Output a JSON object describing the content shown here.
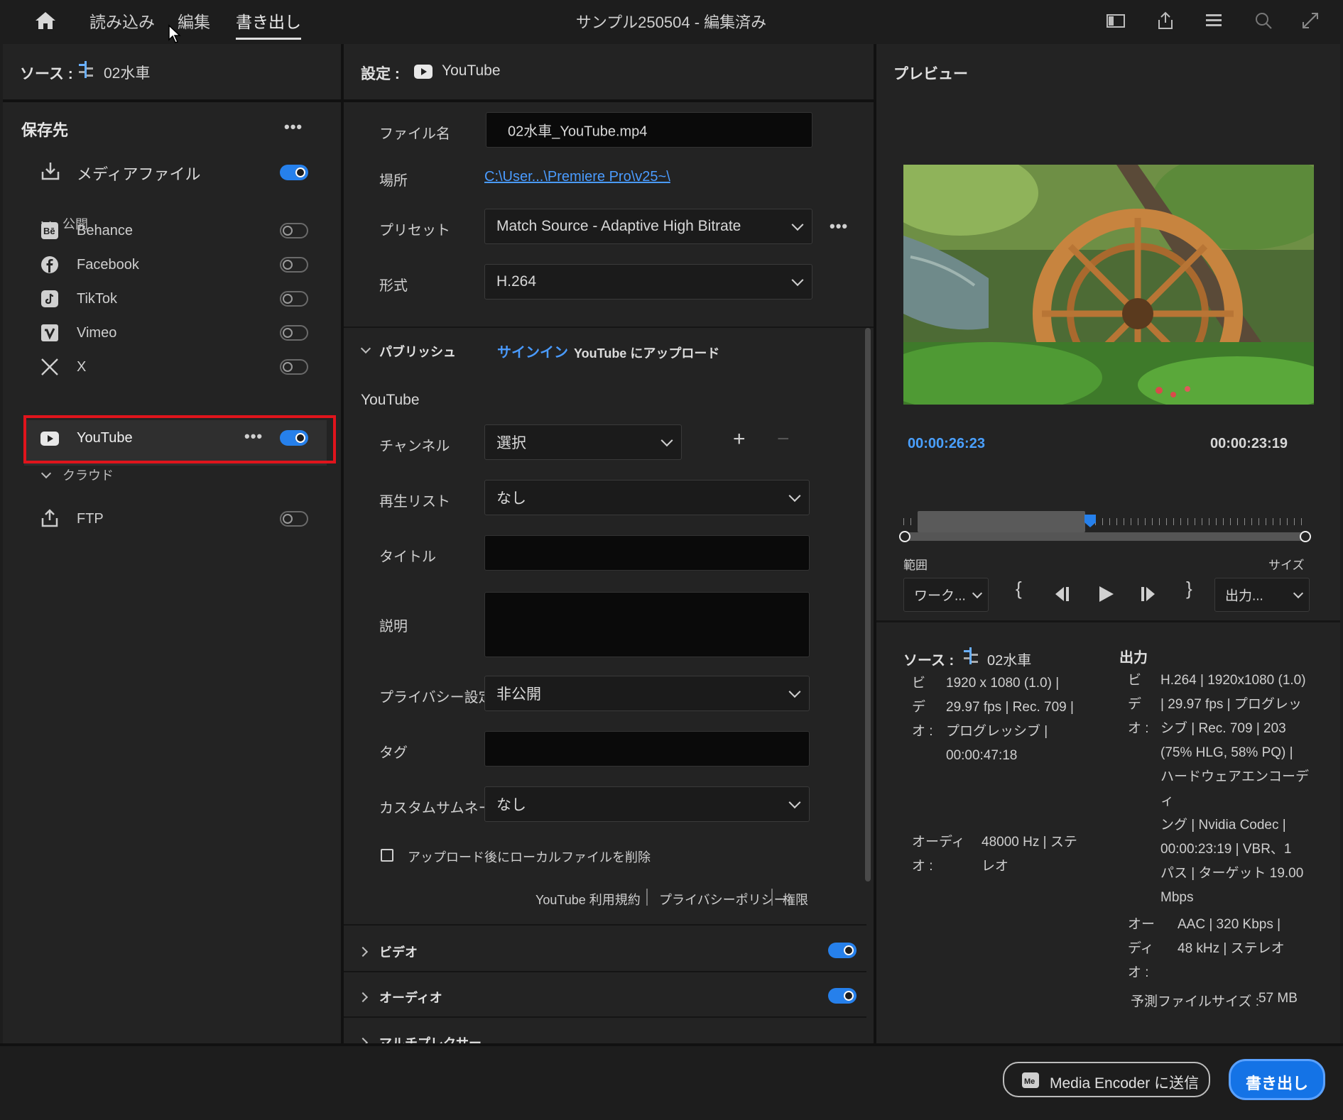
{
  "topbar": {
    "tabs": [
      "読み込み",
      "編集",
      "書き出し"
    ],
    "title": "サンプル250504 - 編集済み"
  },
  "source": {
    "label": "ソース :",
    "name": "02水車"
  },
  "destinations": {
    "header": "保存先",
    "media_file": {
      "label": "メディアファイル",
      "on": true
    },
    "publish_group": "公開",
    "publish_items": [
      {
        "label": "Behance",
        "icon": "behance-icon",
        "on": false
      },
      {
        "label": "Facebook",
        "icon": "facebook-icon",
        "on": false
      },
      {
        "label": "TikTok",
        "icon": "tiktok-icon",
        "on": false
      },
      {
        "label": "Vimeo",
        "icon": "vimeo-icon",
        "on": false
      },
      {
        "label": "X",
        "icon": "x-icon",
        "on": false
      },
      {
        "label": "YouTube",
        "icon": "youtube-icon",
        "on": true
      }
    ],
    "cloud_group": "クラウド",
    "ftp": {
      "label": "FTP",
      "on": false
    },
    "highlight_color": "#e0141c"
  },
  "settings": {
    "label": "設定 :",
    "target": "YouTube",
    "filename_label": "ファイル名",
    "filename_value": "02水車_YouTube.mp4",
    "location_label": "場所",
    "location_value": "C:\\User...\\Premiere Pro\\v25~\\",
    "preset_label": "プリセット",
    "preset_value": "Match Source - Adaptive High Bitrate",
    "format_label": "形式",
    "format_value": "H.264",
    "publish_section": "パブリッシュ",
    "sign_in": "サインイン",
    "upload_text": "YouTube にアップロード",
    "youtube_header": "YouTube",
    "channel_label": "チャンネル",
    "channel_value": "選択",
    "playlist_label": "再生リスト",
    "playlist_value": "なし",
    "title_label": "タイトル",
    "description_label": "説明",
    "privacy_label": "プライバシー設定",
    "privacy_value": "非公開",
    "tag_label": "タグ",
    "thumbnail_label": "カスタムサムネール",
    "thumbnail_value": "なし",
    "delete_checkbox": "アップロード後にローカルファイルを削除",
    "links": [
      "YouTube 利用規約",
      "プライバシーポリシー",
      "権限"
    ],
    "video_section": "ビデオ",
    "audio_section": "オーディオ",
    "mux_section": "マルチプレクサー"
  },
  "preview": {
    "header": "プレビュー",
    "timecode_current": "00:00:26:23",
    "timecode_duration": "00:00:23:19",
    "range_label": "範囲",
    "range_value": "ワーク...",
    "size_label": "サイズ",
    "size_value": "出力..."
  },
  "summary": {
    "source_label": "ソース :",
    "source_name": "02水車",
    "source_video_key": [
      "ビ",
      "デ",
      "オ :"
    ],
    "source_video_lines": [
      "1920 x 1080 (1.0) |",
      "29.97 fps | Rec. 709 |",
      "プログレッシブ |",
      "00:00:47:18"
    ],
    "source_audio_key": [
      "オーディ",
      "オ :"
    ],
    "source_audio_lines": [
      "48000 Hz | ステ",
      "レオ"
    ],
    "output_label": "出力",
    "output_video_key": [
      "ビ",
      "デ",
      "オ :"
    ],
    "output_video_lines": [
      "H.264 | 1920x1080 (1.0)",
      " | 29.97 fps | プログレッ",
      "シブ | Rec. 709 | 203",
      "(75% HLG, 58% PQ) |",
      "ハードウェアエンコーディ",
      "ング | Nvidia Codec |",
      "00:00:23:19 | VBR、1",
      "パス | ターゲット 19.00",
      "Mbps"
    ],
    "output_audio_key": [
      "オー",
      "ディ",
      "オ :"
    ],
    "output_audio_lines": [
      "AAC | 320 Kbps |",
      "48 kHz | ステレオ"
    ],
    "filesize_label": "予測ファイルサイズ :",
    "filesize_value": "57 MB"
  },
  "footer": {
    "media_encoder": "Media Encoder に送信",
    "export": "書き出し"
  },
  "colors": {
    "accent": "#2680eb",
    "timecode": "#4aa0ff",
    "link": "#4a9bff"
  }
}
